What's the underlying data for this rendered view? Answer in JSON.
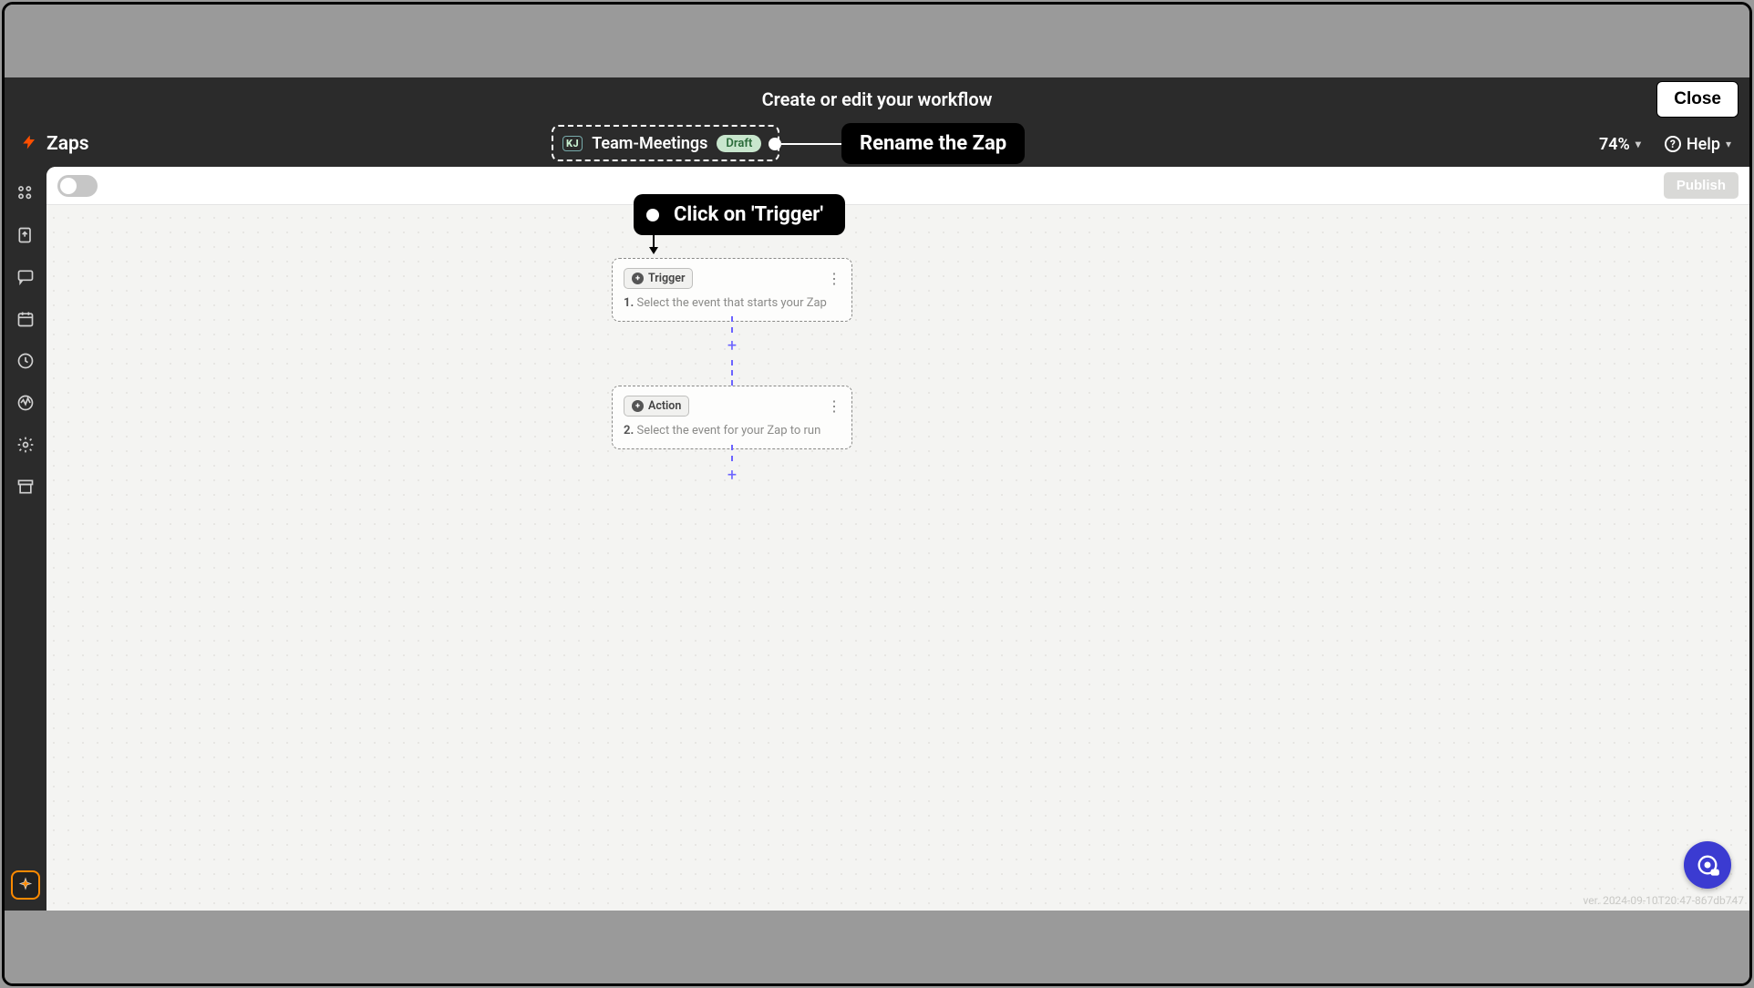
{
  "titlebar": {
    "title": "Create or edit your workflow",
    "close_label": "Close"
  },
  "header": {
    "app_label": "Zaps",
    "workspace_badge": "KJ",
    "zap_name": "Team-Meetings",
    "status_badge": "Draft",
    "zoom": "74%",
    "help_label": "Help"
  },
  "callouts": {
    "rename": "Rename the Zap",
    "trigger": "Click on 'Trigger'"
  },
  "toolbar": {
    "publish_label": "Publish"
  },
  "steps": {
    "trigger": {
      "chip_label": "Trigger",
      "number": "1.",
      "description": "Select the event that starts your Zap"
    },
    "action": {
      "chip_label": "Action",
      "number": "2.",
      "description": "Select the event for your Zap to run"
    }
  },
  "footer": {
    "version": "ver. 2024-09-10T20:47-867db747"
  }
}
